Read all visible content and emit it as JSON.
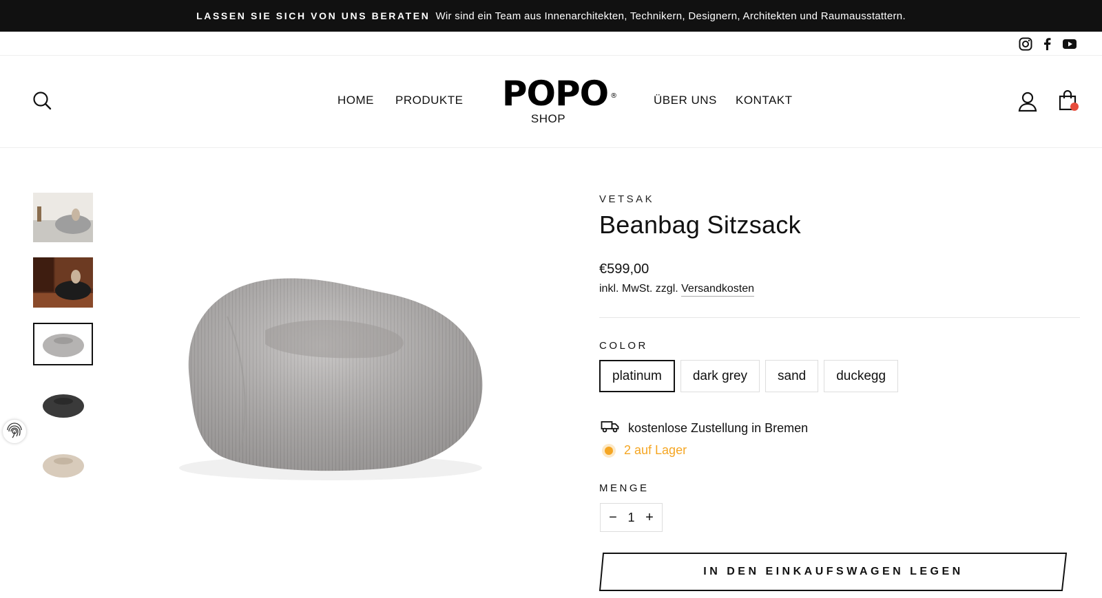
{
  "announcement": {
    "strong": "LASSEN SIE SICH VON UNS BERATEN",
    "text": "Wir sind ein Team aus Innenarchitekten, Technikern, Designern, Architekten und Raumausstattern."
  },
  "social": [
    "instagram-icon",
    "facebook-icon",
    "youtube-icon"
  ],
  "header": {
    "nav": [
      "HOME",
      "PRODUKTE",
      "ÜBER UNS",
      "KONTAKT"
    ],
    "logo_text": "POPO",
    "logo_registered": "®",
    "logo_sub": "SHOP"
  },
  "product": {
    "vendor": "VETSAK",
    "title": "Beanbag Sitzsack",
    "price": "€599,00",
    "tax_prefix": "inkl. MwSt. zzgl.",
    "tax_link": "Versandkosten",
    "color_label": "COLOR",
    "colors": [
      "platinum",
      "dark grey",
      "sand",
      "duckegg"
    ],
    "selected_color": "platinum",
    "delivery": "kostenlose Zustellung in Bremen",
    "stock": "2 auf Lager",
    "quantity_label": "MENGE",
    "quantity": "1",
    "minus": "−",
    "plus": "+",
    "add_to_cart": "IN DEN EINKAUFSWAGEN LEGEN"
  },
  "colors": {
    "announce_bg": "#111111",
    "stock": "#f5a623",
    "cart_dot": "#e74c3c"
  }
}
